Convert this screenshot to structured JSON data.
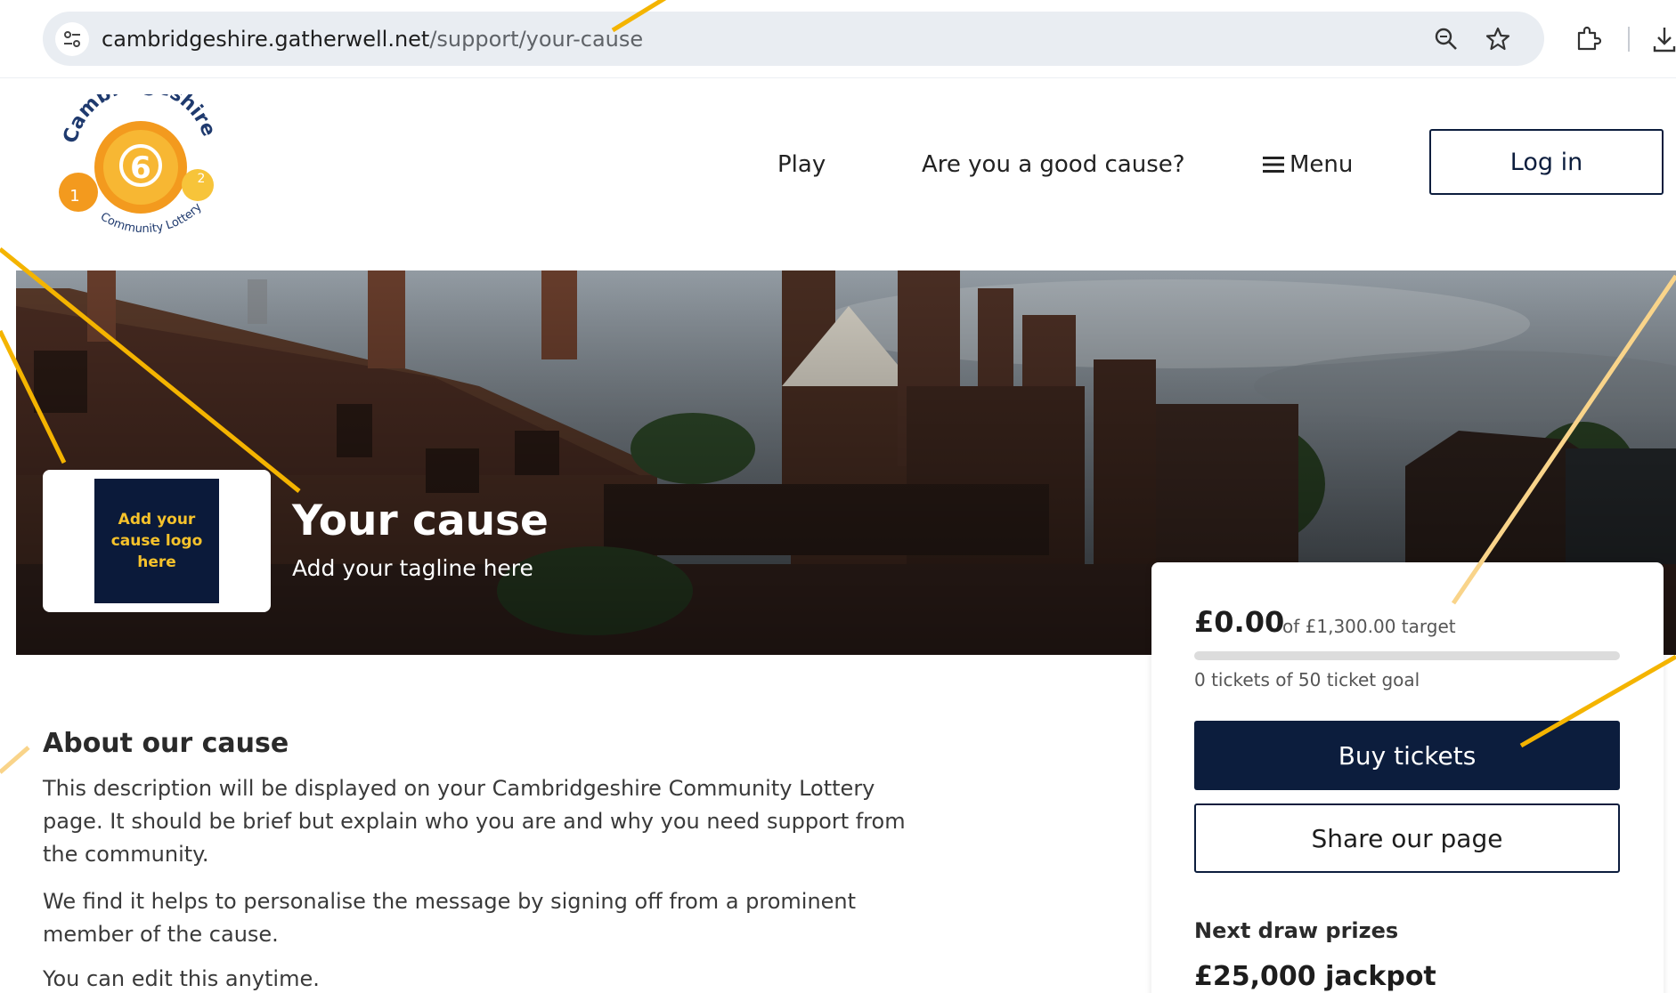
{
  "browser": {
    "url_host": "cambridgeshire.gatherwell.net",
    "url_path": "/support/your-cause",
    "icons": [
      "site-info-icon",
      "zoom-icon",
      "bookmark-star-icon",
      "extensions-icon",
      "download-icon"
    ]
  },
  "header": {
    "logo": {
      "top_text": "Cambridgeshire",
      "bottom_text": "Community Lottery",
      "ball_number": "6",
      "small_ball_1": "1",
      "small_ball_2": "2"
    },
    "nav": {
      "play": "Play",
      "good_cause": "Are you a good cause?",
      "menu": "Menu"
    },
    "login": "Log in"
  },
  "hero": {
    "logo_placeholder": "Add your cause logo here",
    "title": "Your cause",
    "tagline": "Add your tagline here"
  },
  "about": {
    "title": "About our cause",
    "paragraphs": [
      "This description will be displayed on your Cambridgeshire Community Lottery page. It should be brief but explain who you are and why you need support from the community.",
      "We find it helps to personalise the message by signing off from a prominent member of the cause.",
      "You can edit this anytime."
    ]
  },
  "support": {
    "raised": "£0.00",
    "target_text": "of £1,300.00 target",
    "progress_fraction": 0,
    "tickets_text": "0 tickets of 50 ticket goal",
    "buy_label": "Buy tickets",
    "share_label": "Share our page",
    "prizes_label": "Next draw prizes",
    "jackpot": "£25,000 jackpot"
  },
  "colors": {
    "brand_navy": "#0c1d3d",
    "brand_orange": "#f39a1e",
    "annotation_yellow": "#f4b400",
    "annotation_light": "#f9d48a"
  }
}
